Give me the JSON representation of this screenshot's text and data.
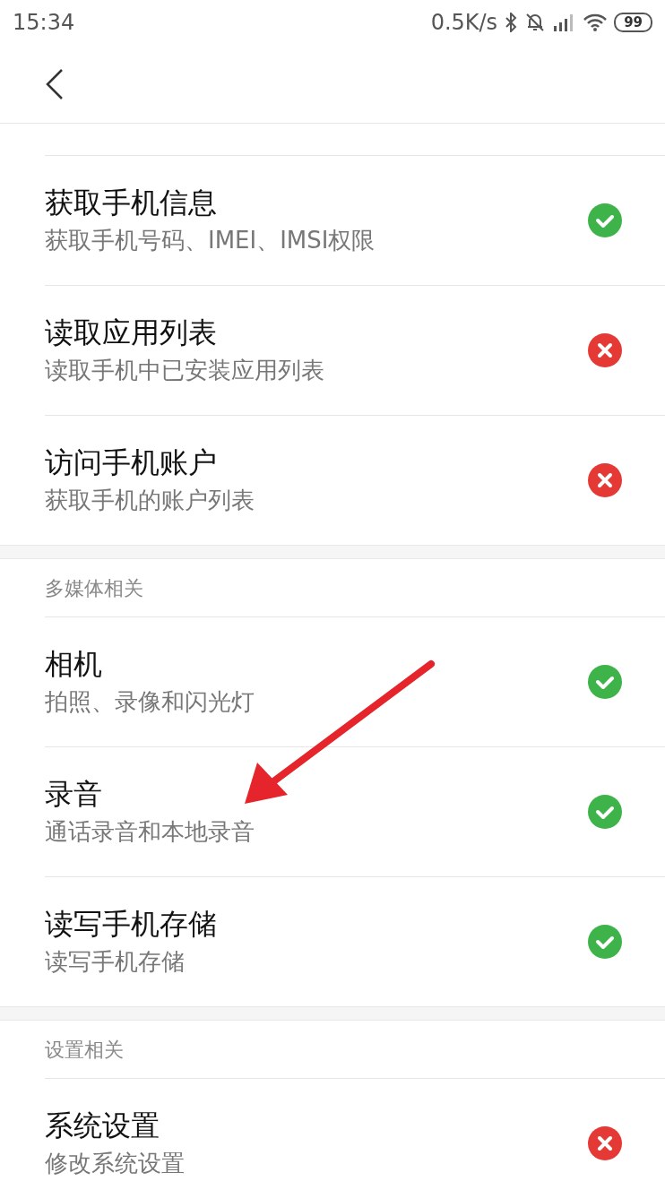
{
  "status_bar": {
    "time": "15:34",
    "network_speed": "0.5K/s",
    "battery": "99"
  },
  "sections": [
    {
      "items": [
        {
          "title": "获取手机信息",
          "subtitle": "获取手机号码、IMEI、IMSI权限",
          "allowed": true
        },
        {
          "title": "读取应用列表",
          "subtitle": "读取手机中已安装应用列表",
          "allowed": false
        },
        {
          "title": "访问手机账户",
          "subtitle": "获取手机的账户列表",
          "allowed": false
        }
      ]
    },
    {
      "title": "多媒体相关",
      "items": [
        {
          "title": "相机",
          "subtitle": "拍照、录像和闪光灯",
          "allowed": true
        },
        {
          "title": "录音",
          "subtitle": "通话录音和本地录音",
          "allowed": true
        },
        {
          "title": "读写手机存储",
          "subtitle": "读写手机存储",
          "allowed": true
        }
      ]
    },
    {
      "title": "设置相关",
      "items": [
        {
          "title": "系统设置",
          "subtitle": "修改系统设置",
          "allowed": false
        }
      ]
    }
  ]
}
